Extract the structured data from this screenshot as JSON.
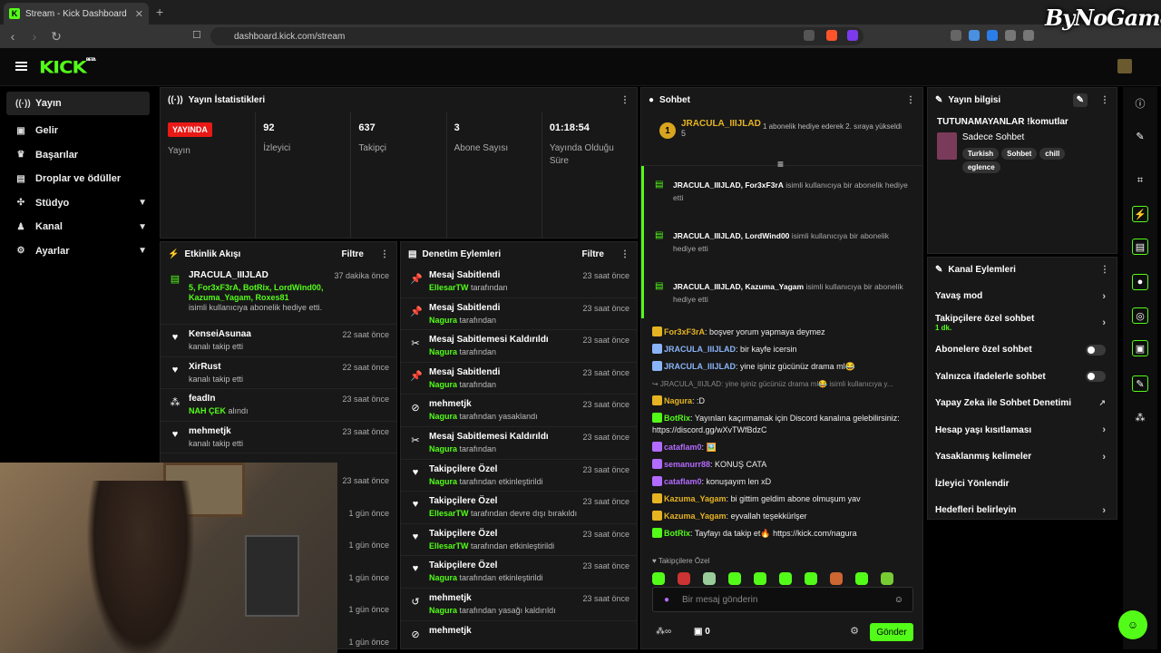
{
  "browser": {
    "tab_title": "Stream - Kick Dashboard",
    "new_tab": "+",
    "url": "dashboard.kick.com/stream",
    "watermark": "ByNoGame"
  },
  "kick": {
    "logo": "KICK",
    "logo_sup": "BETA",
    "accent": "#53fc18"
  },
  "sidebar": {
    "items": [
      {
        "label": "Yayın",
        "icon": "broadcast-icon"
      },
      {
        "label": "Gelir",
        "icon": "money-icon"
      },
      {
        "label": "Başarılar",
        "icon": "trophy-icon"
      },
      {
        "label": "Droplar ve ödüller",
        "icon": "gift-icon"
      },
      {
        "label": "Stüdyo",
        "icon": "studio-icon"
      },
      {
        "label": "Kanal",
        "icon": "channel-icon"
      },
      {
        "label": "Ayarlar",
        "icon": "gear-icon"
      }
    ]
  },
  "stats": {
    "title": "Yayın İstatistikleri",
    "live": "YAYINDA",
    "live_label": "Yayın",
    "viewers": "92",
    "viewers_label": "İzleyici",
    "followers": "637",
    "followers_label": "Takipçi",
    "subs": "3",
    "subs_label": "Abone Sayısı",
    "uptime": "01:18:54",
    "uptime_label": "Yayında Olduğu Süre"
  },
  "activity": {
    "title": "Etkinlik Akışı",
    "filter": "Filtre",
    "items": [
      {
        "name": "JRACULA_IIIJLAD",
        "green": "5, For3xF3rA, BotRix, LordWind00, Kazuma_Yagam, Roxes81",
        "text": "isimli kullanıcıya abonelik hediye etti.",
        "time": "37 dakika önce"
      },
      {
        "name": "KenseiAsunaa",
        "text": "kanalı takip etti",
        "time": "22 saat önce"
      },
      {
        "name": "XirRust",
        "text": "kanalı takip etti",
        "time": "22 saat önce"
      },
      {
        "name": "feadIn",
        "green": "NAH ÇEK",
        "text": "alındı",
        "time": "23 saat önce"
      },
      {
        "name": "mehmetjk",
        "text": "kanalı takip etti",
        "time": "23 saat önce"
      }
    ],
    "hidden_times": [
      "23 saat önce",
      "1 gün önce",
      "1 gün önce",
      "1 gün önce",
      "1 gün önce",
      "1 gün önce"
    ]
  },
  "moderation": {
    "title": "Denetim Eylemleri",
    "filter": "Filtre",
    "items": [
      {
        "title": "Mesaj Sabitlendi",
        "user": "EllesarTW",
        "suffix": "tarafından",
        "time": "23 saat önce",
        "icon": "pin-icon"
      },
      {
        "title": "Mesaj Sabitlendi",
        "user": "Nagura",
        "suffix": "tarafından",
        "time": "23 saat önce",
        "icon": "pin-icon"
      },
      {
        "title": "Mesaj Sabitlemesi Kaldırıldı",
        "user": "Nagura",
        "suffix": "tarafından",
        "time": "23 saat önce",
        "icon": "unpin-icon"
      },
      {
        "title": "Mesaj Sabitlendi",
        "user": "Nagura",
        "suffix": "tarafından",
        "time": "23 saat önce",
        "icon": "pin-icon"
      },
      {
        "title": "mehmetjk",
        "user": "Nagura",
        "suffix": "tarafından yasaklandı",
        "time": "23 saat önce",
        "icon": "ban-icon"
      },
      {
        "title": "Mesaj Sabitlemesi Kaldırıldı",
        "user": "Nagura",
        "suffix": "tarafından",
        "time": "23 saat önce",
        "icon": "unpin-icon"
      },
      {
        "title": "Takipçilere Özel",
        "user": "Nagura",
        "suffix": "tarafından etkinleştirildi",
        "time": "23 saat önce",
        "icon": "heart-icon"
      },
      {
        "title": "Takipçilere Özel",
        "user": "EllesarTW",
        "suffix": "tarafından devre dışı bırakıldı",
        "time": "23 saat önce",
        "icon": "heart-icon"
      },
      {
        "title": "Takipçilere Özel",
        "user": "EllesarTW",
        "suffix": "tarafından etkinleştirildi",
        "time": "23 saat önce",
        "icon": "heart-icon"
      },
      {
        "title": "Takipçilere Özel",
        "user": "Nagura",
        "suffix": "tarafından etkinleştirildi",
        "time": "23 saat önce",
        "icon": "heart-icon"
      },
      {
        "title": "mehmetjk",
        "user": "Nagura",
        "suffix": "tarafından yasağı kaldırıldı",
        "time": "23 saat önce",
        "icon": "unban-icon"
      },
      {
        "title": "mehmetjk",
        "user": "",
        "suffix": "",
        "time": "",
        "icon": "ban-icon"
      }
    ]
  },
  "chat": {
    "title": "Sohbet",
    "pinned_name": "JRACULA_IIIJLAD",
    "pinned_count": "5",
    "pinned_rank": "1",
    "pinned_msg": "1 abonelik hediye ederek 2. sıraya yükseldi",
    "system": [
      {
        "a": "JRACULA_IIIJLAD",
        "b": "For3xF3rA",
        "text": "isimli kullanıcıya bir abonelik hediye etti"
      },
      {
        "a": "JRACULA_IIIJLAD",
        "b": "LordWind00",
        "text": "isimli kullanıcıya bir abonelik hediye etti"
      },
      {
        "a": "JRACULA_IIIJLAD",
        "b": "Kazuma_Yagam",
        "text": "isimli kullanıcıya bir abonelik hediye etti"
      }
    ],
    "messages": [
      {
        "user": "For3xF3rA",
        "color": "#e6b422",
        "text": "boşver yorum yapmaya deymez"
      },
      {
        "user": "JRACULA_IIIJLAD",
        "color": "#8ab4f8",
        "text": "bir kayfe icersin"
      },
      {
        "user": "JRACULA_IIIJLAD",
        "color": "#8ab4f8",
        "text": "yine işiniz gücünüz drama ml😂"
      },
      {
        "user": "",
        "color": "#888",
        "text": "↪ JRACULA_IIIJLAD: yine işiniz gücünüz drama ml😂 isimli kullanıcıya y..."
      },
      {
        "user": "Nagura",
        "color": "#e6b422",
        "text": ":D"
      },
      {
        "user": "BotRix",
        "color": "#53fc18",
        "text": "Yayınları kaçırmamak için Discord kanalına gelebilirsiniz: https://discord.gg/wXvTWfBdzC"
      },
      {
        "user": "cataflam0",
        "color": "#b36bff",
        "text": "🖼️"
      },
      {
        "user": "semanurr88",
        "color": "#b36bff",
        "text": "KONUŞ CATA"
      },
      {
        "user": "cataflam0",
        "color": "#b36bff",
        "text": "konuşayım len xD"
      },
      {
        "user": "Kazuma_Yagam",
        "color": "#e6b422",
        "text": "bi gittim geldim abone olmuşum yav"
      },
      {
        "user": "Kazuma_Yagam",
        "color": "#e6b422",
        "text": "eyvallah teşekkürlşer"
      },
      {
        "user": "BotRix",
        "color": "#53fc18",
        "text": "Tayfayı da takip et🔥 https://kick.com/nagura"
      }
    ],
    "mode": "Takipçilere Özel",
    "placeholder": "Bir mesaj gönderin",
    "points": "0",
    "send": "Gönder"
  },
  "stream_info": {
    "title": "Yayın bilgisi",
    "stream_title": "TUTUNAMAYANLAR !komutlar",
    "category": "Sadece Sohbet",
    "tags": [
      "Turkish",
      "Sohbet",
      "chill",
      "eglence"
    ]
  },
  "channel_actions": {
    "title": "Kanal Eylemleri",
    "items": [
      {
        "label": "Yavaş mod",
        "ctl": "arrow"
      },
      {
        "label": "Takipçilere özel sohbet",
        "sub": "1 dk.",
        "ctl": "arrow"
      },
      {
        "label": "Abonelere özel sohbet",
        "ctl": "toggle"
      },
      {
        "label": "Yalnızca ifadelerle sohbet",
        "ctl": "toggle"
      },
      {
        "label": "Yapay Zeka ile Sohbet Denetimi",
        "ctl": "ext"
      },
      {
        "label": "Hesap yaşı kısıtlaması",
        "ctl": "arrow"
      },
      {
        "label": "Yasaklanmış kelimeler",
        "ctl": "arrow"
      },
      {
        "label": "İzleyici Yönlendir",
        "ctl": "none"
      },
      {
        "label": "Hedefleri belirleyin",
        "ctl": "arrow"
      }
    ]
  }
}
